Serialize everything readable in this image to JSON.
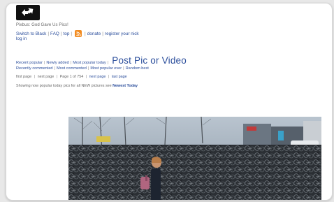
{
  "site": {
    "tagline": "Pixbus: God Gave Us Pics!",
    "links": {
      "switch": "Switch to Black",
      "faq": "FAQ",
      "top": "top",
      "donate": "donate",
      "register": "register your nick",
      "login": "log in"
    }
  },
  "nav": {
    "recent_popular": "Recent popular",
    "newly_added": "Newly added",
    "most_popular_today": "Most popular today",
    "post": "Post Pic or Video",
    "recently_commented": "Recently commented",
    "most_commented": "Most commented",
    "most_popular_ever": "Most popular ever",
    "random": "Random best"
  },
  "paging": {
    "first_page": "first page",
    "next_page": "next page",
    "page_info": "Page 1 of 754",
    "next_page_2": "next page",
    "last_page": "last page"
  },
  "notice": {
    "text": "Showing now popular today pics for all NEW pictures see",
    "link": "Newest Today"
  },
  "colors": {
    "link": "#2a4d9b",
    "rss": "#f28b1f"
  }
}
